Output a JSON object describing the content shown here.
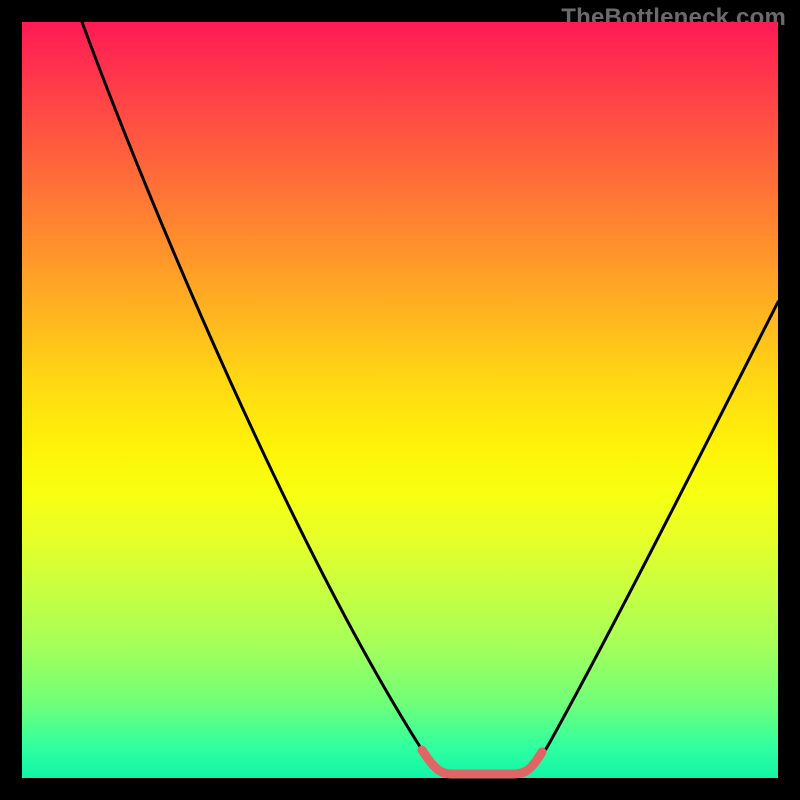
{
  "watermark": "TheBottleneck.com",
  "colors": {
    "background": "#000000",
    "curve_main": "#000000",
    "trough_highlight": "#e06666"
  },
  "chart_data": {
    "type": "line",
    "title": "",
    "xlabel": "",
    "ylabel": "",
    "xlim": [
      0,
      100
    ],
    "ylim": [
      0,
      100
    ],
    "series": [
      {
        "name": "bottleneck-curve",
        "x": [
          8,
          15,
          25,
          35,
          45,
          50,
          55,
          57,
          60,
          63,
          66,
          70,
          75,
          85,
          95,
          100
        ],
        "values": [
          100,
          86,
          66,
          46,
          26,
          16,
          6,
          2,
          1,
          1,
          2,
          6,
          15,
          34,
          53,
          63
        ]
      }
    ],
    "annotations": [
      {
        "name": "trough-highlight",
        "x_range": [
          55,
          67
        ],
        "y": 1,
        "color": "#e06666"
      }
    ]
  }
}
